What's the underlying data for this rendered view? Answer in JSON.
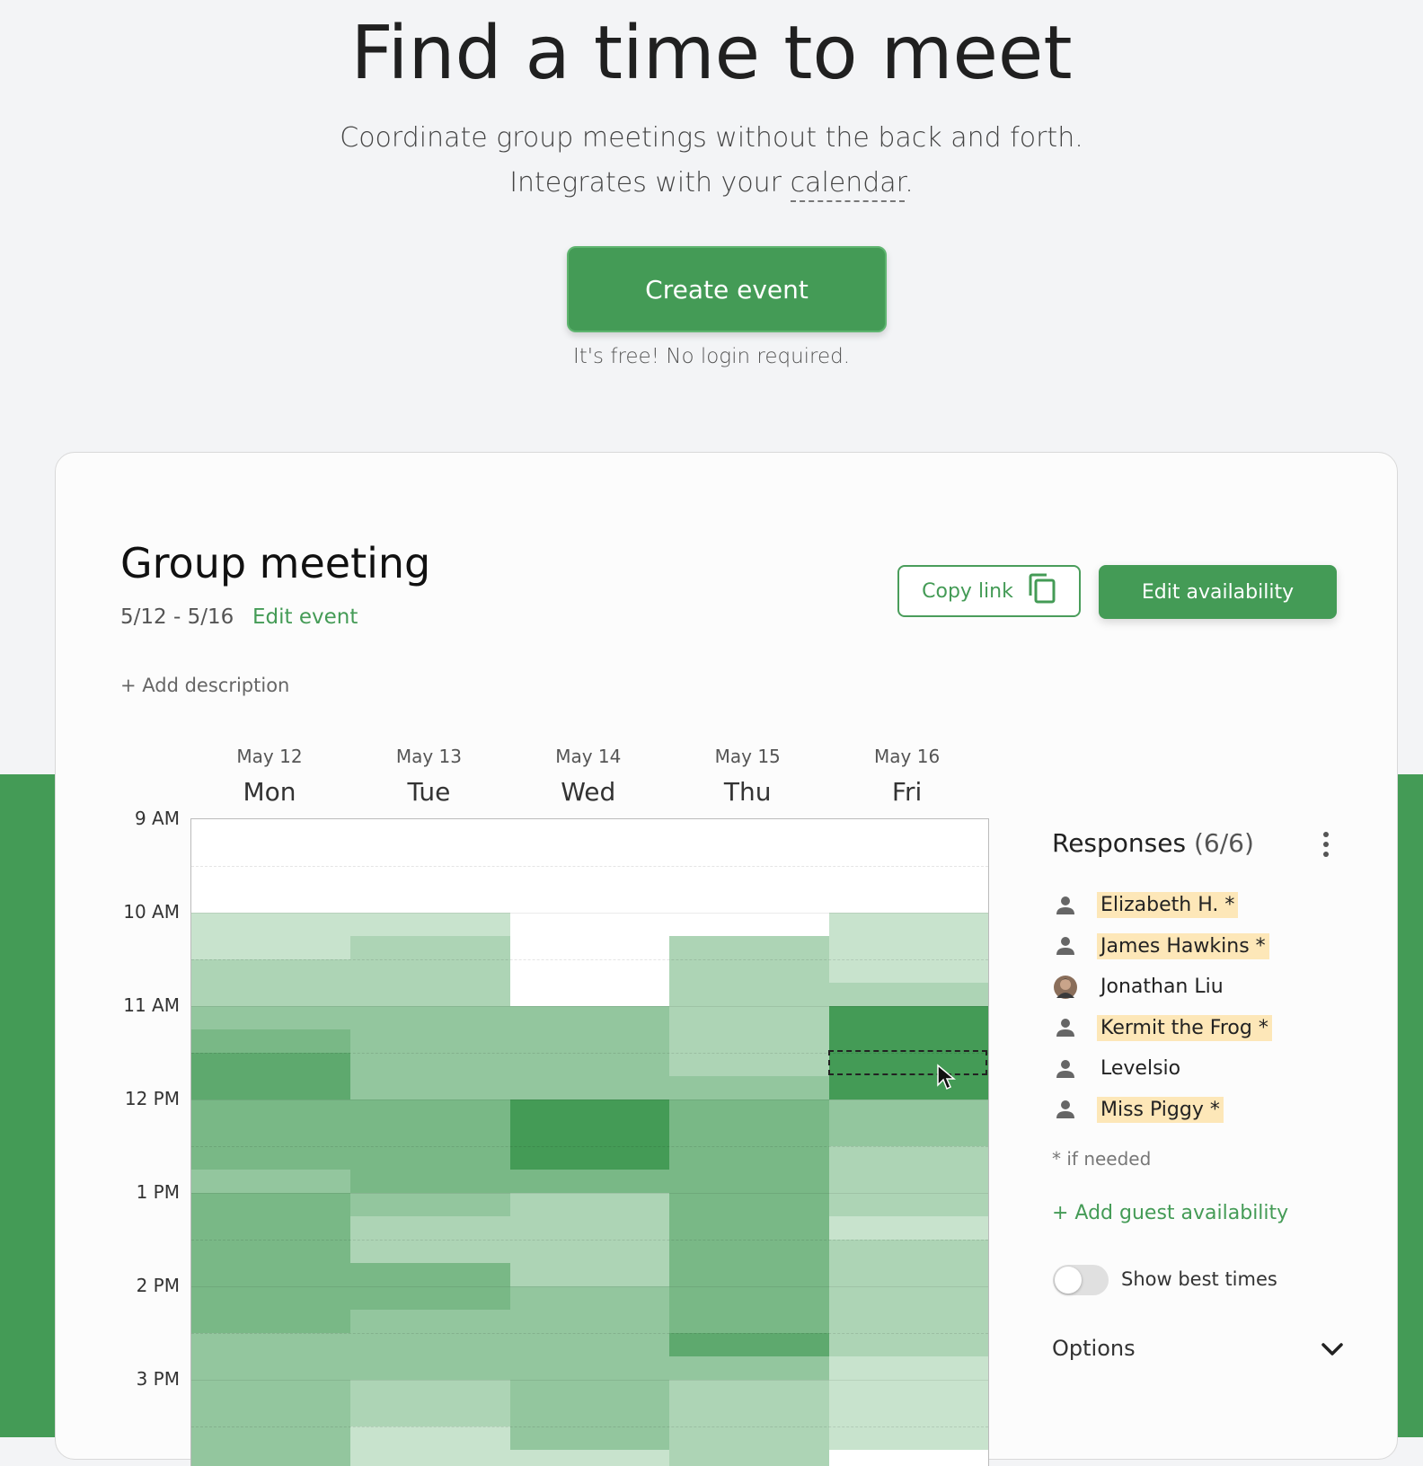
{
  "hero": {
    "title": "Find a time to meet",
    "subtitle_line1": "Coordinate group meetings without the back and forth.",
    "subtitle_line2_prefix": "Integrates with your ",
    "subtitle_line2_link": "calendar",
    "subtitle_line2_suffix": ".",
    "create_button": "Create event",
    "note": "It's free! No login required."
  },
  "event": {
    "title": "Group meeting",
    "dates": "5/12 - 5/16",
    "edit_event": "Edit event",
    "add_description": "+ Add description",
    "copy_link": "Copy link",
    "edit_availability": "Edit availability"
  },
  "days": [
    {
      "date": "May 12",
      "name": "Mon"
    },
    {
      "date": "May 13",
      "name": "Tue"
    },
    {
      "date": "May 14",
      "name": "Wed"
    },
    {
      "date": "May 15",
      "name": "Thu"
    },
    {
      "date": "May 16",
      "name": "Fri"
    }
  ],
  "times": [
    "9 AM",
    "10 AM",
    "11 AM",
    "12 PM",
    "1 PM",
    "2 PM",
    "3 PM"
  ],
  "availability": {
    "slot_minutes": 15,
    "max_responses": 6,
    "counts": [
      [
        0,
        0,
        0,
        0,
        1,
        1,
        2,
        2,
        3,
        4,
        5,
        5,
        4,
        4,
        4,
        3,
        4,
        4,
        4,
        4,
        4,
        4,
        3,
        3,
        3,
        3,
        3,
        3
      ],
      [
        0,
        0,
        0,
        0,
        1,
        2,
        2,
        2,
        3,
        3,
        3,
        3,
        4,
        4,
        4,
        4,
        3,
        2,
        2,
        4,
        4,
        3,
        3,
        3,
        2,
        2,
        1,
        1
      ],
      [
        0,
        0,
        0,
        0,
        0,
        0,
        0,
        0,
        3,
        3,
        3,
        3,
        6,
        6,
        6,
        4,
        2,
        2,
        2,
        2,
        3,
        3,
        3,
        3,
        3,
        3,
        3,
        1
      ],
      [
        0,
        0,
        0,
        0,
        0,
        2,
        2,
        2,
        2,
        2,
        2,
        3,
        4,
        4,
        4,
        4,
        4,
        4,
        4,
        4,
        4,
        4,
        5,
        3,
        2,
        2,
        2,
        2
      ],
      [
        0,
        0,
        0,
        0,
        1,
        1,
        1,
        2,
        6,
        6,
        6,
        6,
        3,
        3,
        2,
        2,
        2,
        1,
        2,
        2,
        2,
        2,
        2,
        1,
        1,
        1,
        1,
        0
      ]
    ]
  },
  "colors": {
    "green": "#449b56",
    "grid_empty": "#ffffff",
    "highlight": "#fde7b8"
  },
  "responses": {
    "title": "Responses",
    "count": "(6/6)",
    "people": [
      {
        "name": "Elizabeth H. *",
        "if_needed": true,
        "icon": "person-icon"
      },
      {
        "name": "James Hawkins *",
        "if_needed": true,
        "icon": "person-icon"
      },
      {
        "name": "Jonathan Liu",
        "if_needed": false,
        "icon": "avatar-photo-icon"
      },
      {
        "name": "Kermit the Frog *",
        "if_needed": true,
        "icon": "person-icon"
      },
      {
        "name": "Levelsio",
        "if_needed": false,
        "icon": "person-icon"
      },
      {
        "name": "Miss Piggy *",
        "if_needed": true,
        "icon": "person-icon"
      }
    ],
    "if_needed_note": "* if needed",
    "add_guest": "+ Add guest availability",
    "show_best_times": "Show best times",
    "show_best_times_on": false,
    "options": "Options"
  }
}
